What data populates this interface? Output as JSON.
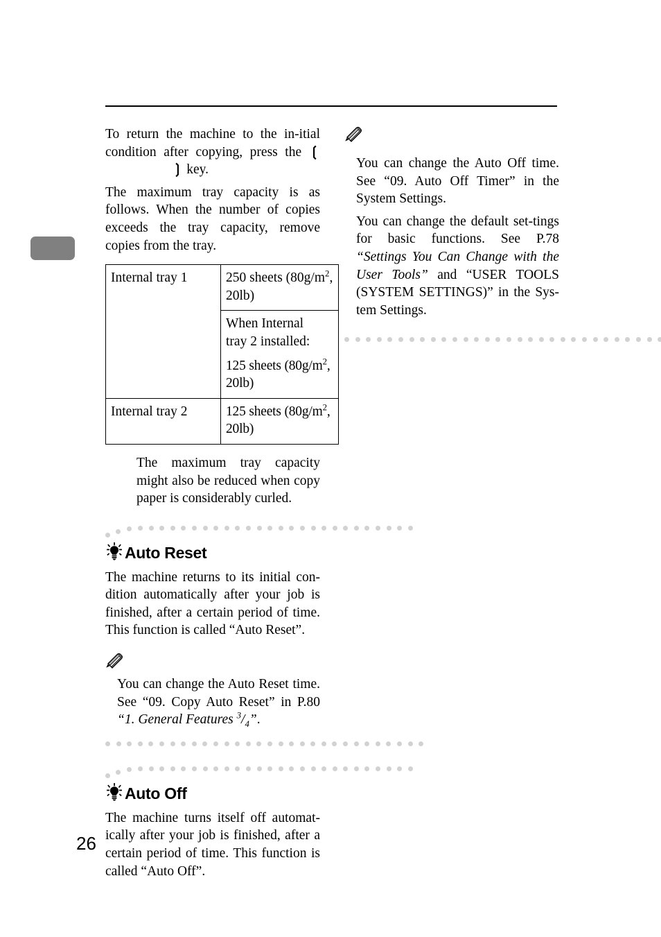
{
  "page": {
    "number": "26"
  },
  "left_column": {
    "para_return": {
      "before_bracket": "To return the machine to the in-itial condition after copying, press the ",
      "bracket_open": "❲",
      "bracket_close": "❳",
      "after_bracket": " key."
    },
    "para_capacity": "The maximum tray capacity is as follows. When the number of copies exceeds the tray capacity, remove copies from the tray.",
    "tray_table": {
      "rows": [
        {
          "tray": "Internal tray 1",
          "capacity_lines": [
            {
              "prefix": "250 sheets (80g/",
              "suffix_pre": "m",
              "sup": "2",
              "suffix_post": ", 20lb)"
            }
          ]
        },
        {
          "tray": "",
          "note_line1": "When Internal",
          "note_line2": "tray 2 installed:",
          "capacity_pre": "125 sheets (80g/m",
          "capacity_sup": "2",
          "capacity_post": ",",
          "capacity_second_line": "20lb)"
        },
        {
          "tray": "Internal tray 2",
          "capacity_pre": "125 sheets (80g/m",
          "capacity_sup": "2",
          "capacity_post": ",",
          "capacity_second_line": "20lb)"
        }
      ]
    },
    "para_curled": "The maximum tray capacity might also be reduced when copy paper is considerably curled."
  },
  "right_column": {
    "note_auto_off": {
      "icon": "pencil-icon",
      "para1": "You can change the Auto Off time. See “09. Auto Off Timer” in the System Settings.",
      "para2_part1": "You can change the default set-tings for basic functions. See P.78 ",
      "para2_italic1": "“Settings You Can Change with the User Tools”",
      "para2_part2": " and “USER TOOLS (SYSTEM SETTINGS)” in the Sys-tem Settings."
    }
  },
  "section_auto_reset": {
    "icon": "lightbulb-icon",
    "title": "Auto Reset",
    "body": "The machine returns to its initial con-dition automatically after your job is finished, after a certain period of time. This function is called “Auto Reset”.",
    "note": {
      "icon": "pencil-icon",
      "text_part1": "You can change the Auto Reset time. See “09. Copy Auto Reset” in P.80 ",
      "text_italic_open": "“1. General Features ",
      "frac_num": "3",
      "frac_sep": "/",
      "frac_den": "4",
      "text_italic_close": "”",
      "text_part2": "."
    }
  },
  "section_auto_off": {
    "icon": "lightbulb-icon",
    "title": "Auto Off",
    "body": "The machine turns itself off automat-ically after your job is finished, after a certain period of time. This function is called “Auto Off”."
  }
}
